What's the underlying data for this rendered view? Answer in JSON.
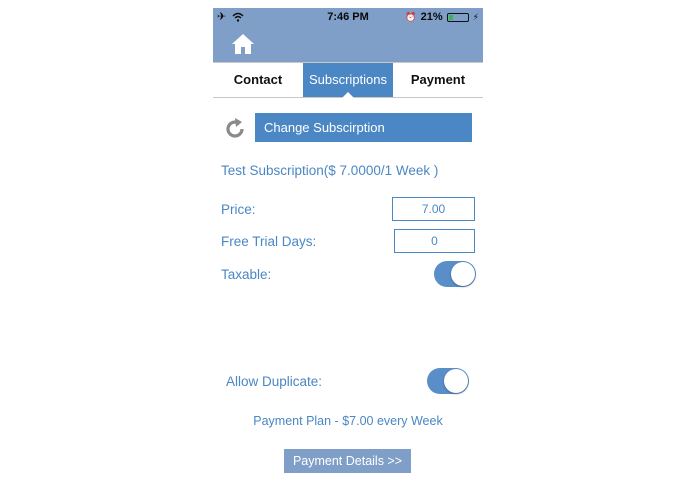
{
  "status_bar": {
    "time": "7:46 PM",
    "battery": "21%",
    "battery_level": 0.21
  },
  "tabs": [
    {
      "label": "Contact",
      "active": false
    },
    {
      "label": "Subscriptions",
      "active": true
    },
    {
      "label": "Payment",
      "active": false
    }
  ],
  "change_button": "Change Subscirption",
  "subscription_name": "Test Subscription($ 7.0000/1 Week )",
  "form": {
    "price_label": "Price:",
    "price_value": "7.00",
    "trial_label": "Free Trial Days:",
    "trial_value": "0",
    "taxable_label": "Taxable:",
    "taxable_on": true,
    "duplicate_label": "Allow Duplicate:",
    "duplicate_on": true
  },
  "payment_plan": "Payment Plan - $7.00 every Week",
  "details_button": "Payment Details >>",
  "colors": {
    "accent": "#4a87c4",
    "navbar": "#7f9fc8",
    "battery": "#3fb34f"
  },
  "icons": [
    "airplane-icon",
    "wifi-icon",
    "alarm-icon",
    "battery-icon",
    "charging-icon",
    "home-icon",
    "refresh-icon"
  ]
}
